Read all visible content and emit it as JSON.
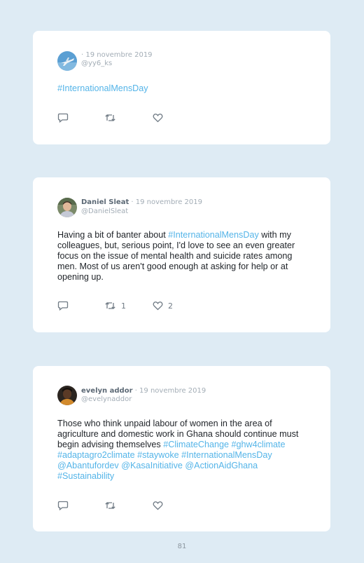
{
  "tweets": [
    {
      "author": "",
      "date": "· 19 novembre 2019",
      "handle": "@yy6_ks",
      "text": [
        {
          "t": "#InternationalMensDay",
          "tag": true
        }
      ],
      "replies": "",
      "retweets": "",
      "likes": "",
      "avatar_icon": "airplane-avatar-icon"
    },
    {
      "author": "Daniel Sleat",
      "date": "· 19 novembre 2019",
      "handle": "@DanielSleat",
      "text": [
        {
          "t": "Having a bit of banter about ",
          "tag": false
        },
        {
          "t": "#InternationalMensDay",
          "tag": true
        },
        {
          "t": " with my colleagues, but, serious point, I'd love to see an even greater focus on the issue of mental health and suicide rates among men. Most of us aren't good enough at asking for help or at opening up.",
          "tag": false
        }
      ],
      "replies": "",
      "retweets": "1",
      "likes": "2",
      "avatar_icon": "person-avatar-icon"
    },
    {
      "author": "evelyn addor",
      "date": "· 19 novembre 2019",
      "handle": "@evelynaddor",
      "text": [
        {
          "t": "Those who think unpaid labour of women in the area of agriculture and domestic work in Ghana should continue must begin advising themselves ",
          "tag": false
        },
        {
          "t": "#ClimateChange #ghw4climate #adaptagro2climate #staywoke #InternationalMensDay @Abantufordev @KasaInitiative @ActionAidGhana #Sustainability",
          "tag": true
        }
      ],
      "replies": "",
      "retweets": "",
      "likes": "",
      "avatar_icon": "person-avatar-icon"
    }
  ],
  "page_number": "81",
  "colors": {
    "background": "#deebf4",
    "card": "#ffffff",
    "hashtag": "#54b4e8",
    "meta": "#a3adb6",
    "icon": "#6f7a84"
  }
}
